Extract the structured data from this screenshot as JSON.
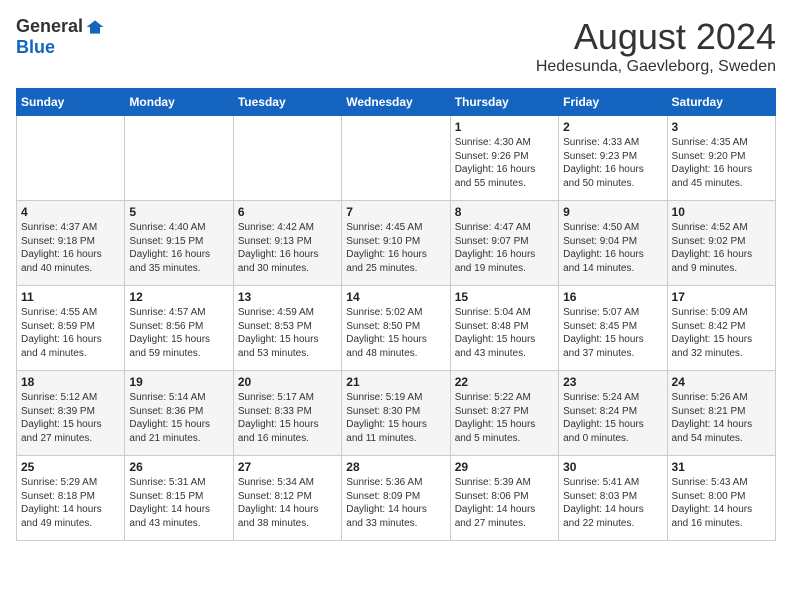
{
  "logo": {
    "general": "General",
    "blue": "Blue"
  },
  "title": {
    "month_year": "August 2024",
    "location": "Hedesunda, Gaevleborg, Sweden"
  },
  "headers": [
    "Sunday",
    "Monday",
    "Tuesday",
    "Wednesday",
    "Thursday",
    "Friday",
    "Saturday"
  ],
  "weeks": [
    [
      {
        "day": "",
        "info": ""
      },
      {
        "day": "",
        "info": ""
      },
      {
        "day": "",
        "info": ""
      },
      {
        "day": "",
        "info": ""
      },
      {
        "day": "1",
        "info": "Sunrise: 4:30 AM\nSunset: 9:26 PM\nDaylight: 16 hours\nand 55 minutes."
      },
      {
        "day": "2",
        "info": "Sunrise: 4:33 AM\nSunset: 9:23 PM\nDaylight: 16 hours\nand 50 minutes."
      },
      {
        "day": "3",
        "info": "Sunrise: 4:35 AM\nSunset: 9:20 PM\nDaylight: 16 hours\nand 45 minutes."
      }
    ],
    [
      {
        "day": "4",
        "info": "Sunrise: 4:37 AM\nSunset: 9:18 PM\nDaylight: 16 hours\nand 40 minutes."
      },
      {
        "day": "5",
        "info": "Sunrise: 4:40 AM\nSunset: 9:15 PM\nDaylight: 16 hours\nand 35 minutes."
      },
      {
        "day": "6",
        "info": "Sunrise: 4:42 AM\nSunset: 9:13 PM\nDaylight: 16 hours\nand 30 minutes."
      },
      {
        "day": "7",
        "info": "Sunrise: 4:45 AM\nSunset: 9:10 PM\nDaylight: 16 hours\nand 25 minutes."
      },
      {
        "day": "8",
        "info": "Sunrise: 4:47 AM\nSunset: 9:07 PM\nDaylight: 16 hours\nand 19 minutes."
      },
      {
        "day": "9",
        "info": "Sunrise: 4:50 AM\nSunset: 9:04 PM\nDaylight: 16 hours\nand 14 minutes."
      },
      {
        "day": "10",
        "info": "Sunrise: 4:52 AM\nSunset: 9:02 PM\nDaylight: 16 hours\nand 9 minutes."
      }
    ],
    [
      {
        "day": "11",
        "info": "Sunrise: 4:55 AM\nSunset: 8:59 PM\nDaylight: 16 hours\nand 4 minutes."
      },
      {
        "day": "12",
        "info": "Sunrise: 4:57 AM\nSunset: 8:56 PM\nDaylight: 15 hours\nand 59 minutes."
      },
      {
        "day": "13",
        "info": "Sunrise: 4:59 AM\nSunset: 8:53 PM\nDaylight: 15 hours\nand 53 minutes."
      },
      {
        "day": "14",
        "info": "Sunrise: 5:02 AM\nSunset: 8:50 PM\nDaylight: 15 hours\nand 48 minutes."
      },
      {
        "day": "15",
        "info": "Sunrise: 5:04 AM\nSunset: 8:48 PM\nDaylight: 15 hours\nand 43 minutes."
      },
      {
        "day": "16",
        "info": "Sunrise: 5:07 AM\nSunset: 8:45 PM\nDaylight: 15 hours\nand 37 minutes."
      },
      {
        "day": "17",
        "info": "Sunrise: 5:09 AM\nSunset: 8:42 PM\nDaylight: 15 hours\nand 32 minutes."
      }
    ],
    [
      {
        "day": "18",
        "info": "Sunrise: 5:12 AM\nSunset: 8:39 PM\nDaylight: 15 hours\nand 27 minutes."
      },
      {
        "day": "19",
        "info": "Sunrise: 5:14 AM\nSunset: 8:36 PM\nDaylight: 15 hours\nand 21 minutes."
      },
      {
        "day": "20",
        "info": "Sunrise: 5:17 AM\nSunset: 8:33 PM\nDaylight: 15 hours\nand 16 minutes."
      },
      {
        "day": "21",
        "info": "Sunrise: 5:19 AM\nSunset: 8:30 PM\nDaylight: 15 hours\nand 11 minutes."
      },
      {
        "day": "22",
        "info": "Sunrise: 5:22 AM\nSunset: 8:27 PM\nDaylight: 15 hours\nand 5 minutes."
      },
      {
        "day": "23",
        "info": "Sunrise: 5:24 AM\nSunset: 8:24 PM\nDaylight: 15 hours\nand 0 minutes."
      },
      {
        "day": "24",
        "info": "Sunrise: 5:26 AM\nSunset: 8:21 PM\nDaylight: 14 hours\nand 54 minutes."
      }
    ],
    [
      {
        "day": "25",
        "info": "Sunrise: 5:29 AM\nSunset: 8:18 PM\nDaylight: 14 hours\nand 49 minutes."
      },
      {
        "day": "26",
        "info": "Sunrise: 5:31 AM\nSunset: 8:15 PM\nDaylight: 14 hours\nand 43 minutes."
      },
      {
        "day": "27",
        "info": "Sunrise: 5:34 AM\nSunset: 8:12 PM\nDaylight: 14 hours\nand 38 minutes."
      },
      {
        "day": "28",
        "info": "Sunrise: 5:36 AM\nSunset: 8:09 PM\nDaylight: 14 hours\nand 33 minutes."
      },
      {
        "day": "29",
        "info": "Sunrise: 5:39 AM\nSunset: 8:06 PM\nDaylight: 14 hours\nand 27 minutes."
      },
      {
        "day": "30",
        "info": "Sunrise: 5:41 AM\nSunset: 8:03 PM\nDaylight: 14 hours\nand 22 minutes."
      },
      {
        "day": "31",
        "info": "Sunrise: 5:43 AM\nSunset: 8:00 PM\nDaylight: 14 hours\nand 16 minutes."
      }
    ]
  ]
}
